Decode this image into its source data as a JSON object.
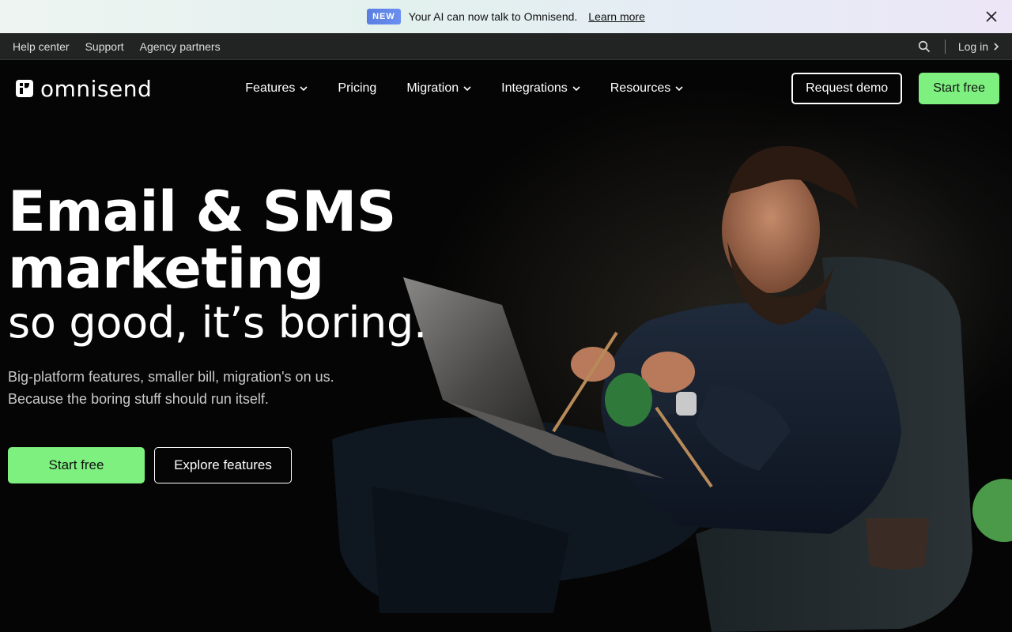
{
  "announcement": {
    "badge": "NEW",
    "text": "Your AI can now talk to Omnisend.",
    "link": "Learn more"
  },
  "utility": {
    "links": [
      "Help center",
      "Support",
      "Agency partners"
    ],
    "login": "Log in"
  },
  "nav": {
    "logo": "omnisend",
    "items": [
      {
        "label": "Features",
        "has_dropdown": true
      },
      {
        "label": "Pricing",
        "has_dropdown": false
      },
      {
        "label": "Migration",
        "has_dropdown": true
      },
      {
        "label": "Integrations",
        "has_dropdown": true
      },
      {
        "label": "Resources",
        "has_dropdown": true
      }
    ],
    "request_demo": "Request demo",
    "start_free": "Start free"
  },
  "hero": {
    "headline_line1": "Email & SMS",
    "headline_line2": "marketing",
    "headline_line3": "so good, it’s boring.",
    "sub_line1": "Big-platform features, smaller bill, migration's on us.",
    "sub_line2": "Because the boring stuff should run itself.",
    "cta_primary": "Start free",
    "cta_secondary": "Explore features"
  },
  "colors": {
    "accent_green": "#7ef07f",
    "badge_blue": "#5a7fe0",
    "utility_bg": "#222423",
    "hero_bg": "#050505"
  }
}
